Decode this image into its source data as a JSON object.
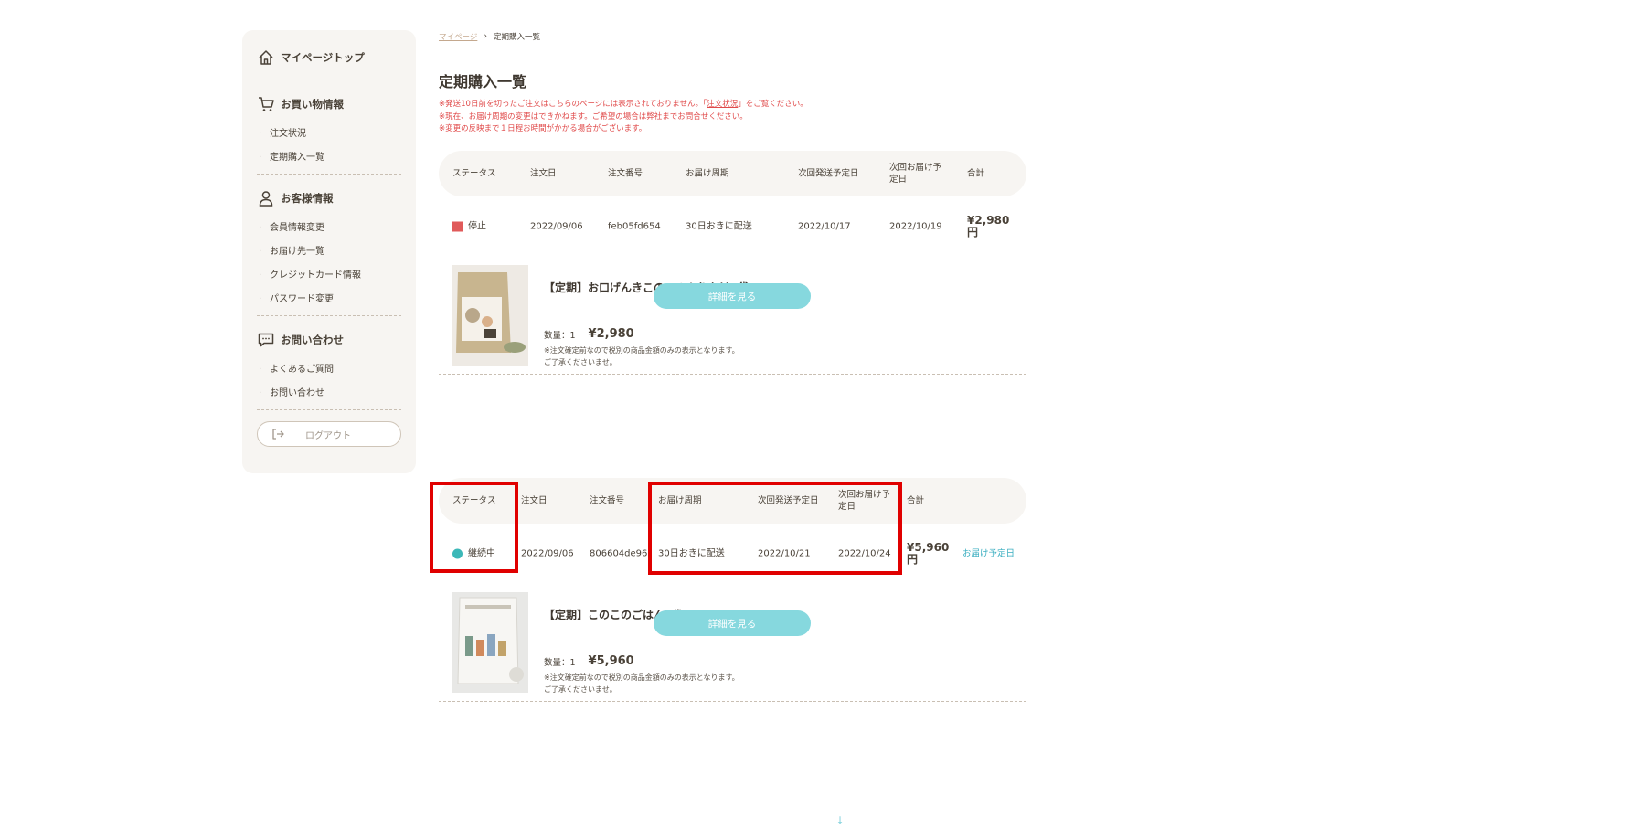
{
  "sidebar": {
    "mypage_top": "マイページトップ",
    "shopping": {
      "title": "お買い物情報",
      "items": [
        "注文状況",
        "定期購入一覧"
      ]
    },
    "customer": {
      "title": "お客様情報",
      "items": [
        "会員情報変更",
        "お届け先一覧",
        "クレジットカード情報",
        "パスワード変更"
      ]
    },
    "contact": {
      "title": "お問い合わせ",
      "items": [
        "よくあるご質問",
        "お問い合わせ"
      ]
    },
    "logout": "ログアウト"
  },
  "breadcrumb": {
    "home": "マイページ",
    "current": "定期購入一覧"
  },
  "page_title": "定期購入一覧",
  "notices": {
    "line1_before": "※発送10日前を切ったご注文はこちらのページには表示されておりません。「",
    "line1_link": "注文状況",
    "line1_after": "」をご覧ください。",
    "line2": "※現在、お届け周期の変更はできかねます。ご希望の場合は弊社までお問合せください。",
    "line3": "※変更の反映まで１日程お時間がかかる場合がございます。"
  },
  "headers": {
    "status": "ステータス",
    "order_date": "注文日",
    "order_no": "注文番号",
    "cycle": "お届け周期",
    "next_ship": "次回発送予定日",
    "next_delivery_l1": "次回お届け予",
    "next_delivery_l2": "定日",
    "total": "合計"
  },
  "subscriptions": [
    {
      "status": "停止",
      "status_color": "#e05a5a",
      "order_date": "2022/09/06",
      "order_no": "feb05fd654",
      "cycle": "30日おきに配送",
      "next_ship": "2022/10/17",
      "next_delivery": "2022/10/19",
      "total_amount": "¥2,980",
      "total_unit": "円",
      "product_name": "【定期】お口げんきこのこのふりかけ1袋",
      "qty_label": "数量：1",
      "price": "¥2,980",
      "note1": "※注文確定前なので税別の商品金額のみの表示となります。",
      "note2": "ご了承くださいませ。",
      "detail_button": "詳細を見る"
    },
    {
      "status": "継続中",
      "status_color": "#3cb8b8",
      "order_date": "2022/09/06",
      "order_no": "806604de96",
      "cycle": "30日おきに配送",
      "next_ship": "2022/10/21",
      "next_delivery": "2022/10/24",
      "total_amount": "¥5,960",
      "total_unit": "円",
      "extra_link": "お届け予定日",
      "product_name": "【定期】このこのごはん2袋",
      "qty_label": "数量：1",
      "price": "¥5,960",
      "note1": "※注文確定前なので税別の商品金額のみの表示となります。",
      "note2": "ご了承くださいませ。",
      "detail_button": "詳細を見る"
    }
  ],
  "colors": {
    "highlight": "#e00000",
    "accent": "#86d8de",
    "sidebar_bg": "#f7f5f2"
  }
}
